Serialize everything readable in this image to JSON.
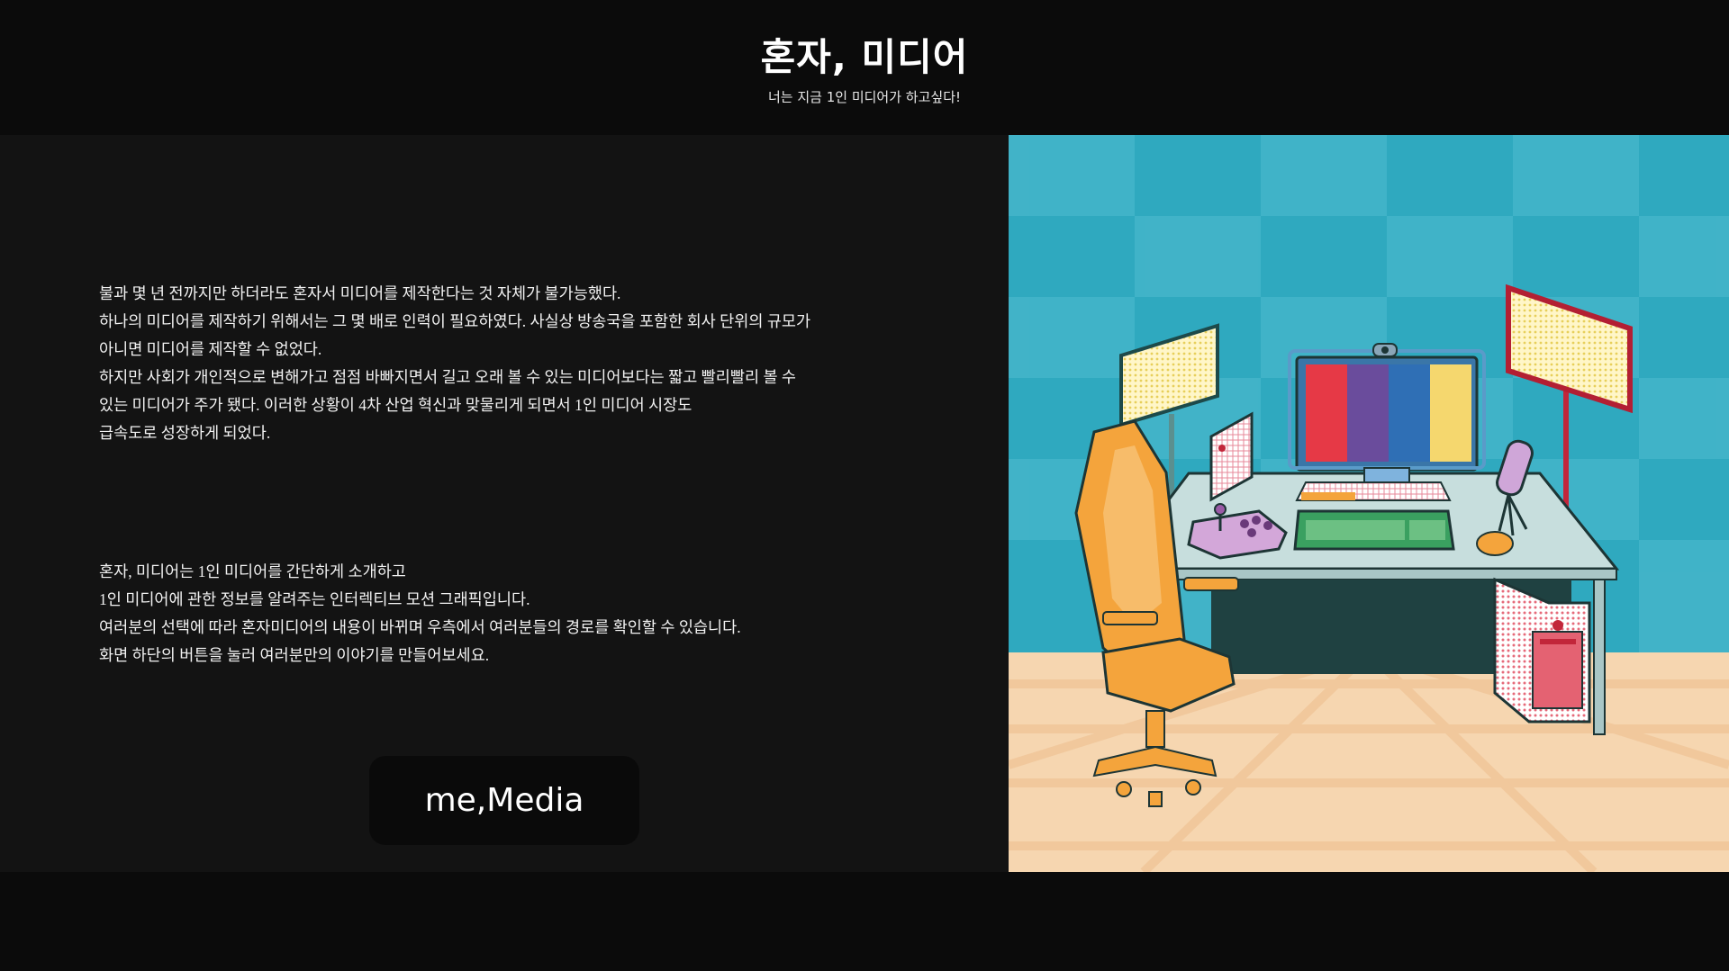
{
  "header": {
    "title": "혼자, 미디어",
    "subtitle": "너는 지금 1인 미디어가 하고싶다!"
  },
  "intro": {
    "lines": [
      "불과 몇 년 전까지만 하더라도 혼자서 미디어를 제작한다는 것 자체가 불가능했다.",
      "하나의 미디어를 제작하기 위해서는 그 몇 배로 인력이 필요하였다. 사실상 방송국을 포함한 회사 단위의 규모가",
      "아니면 미디어를 제작할 수 없었다.",
      "하지만 사회가 개인적으로 변해가고 점점 바빠지면서 길고 오래 볼 수 있는 미디어보다는 짧고 빨리빨리 볼 수",
      "있는 미디어가 주가 됐다. 이러한 상황이 4차 산업 혁신과 맞물리게 되면서 1인 미디어 시장도",
      "급속도로 성장하게 되었다."
    ]
  },
  "about": {
    "lines": [
      "혼자, 미디어는 1인 미디어를 간단하게 소개하고",
      "1인 미디어에 관한 정보를 알려주는 인터렉티브 모션 그래픽입니다.",
      "여러분의 선택에 따라 혼자미디어의 내용이 바뀌며 우측에서 여러분들의 경로를 확인할 수 있습니다.",
      "화면 하단의 버튼을 눌러 여러분만의 이야기를 만들어보세요."
    ]
  },
  "cta": {
    "label": "me,Media"
  },
  "illustration": {
    "subject": "streamer desk setup",
    "colors": {
      "wall": "#3aaec4",
      "floor": "#f5d2a8",
      "chair": "#f4a43c",
      "desk": "#c5dede",
      "monitor_stripes": [
        "#e63946",
        "#6a4c9c",
        "#2f6fb5",
        "#f5d76e"
      ]
    }
  }
}
